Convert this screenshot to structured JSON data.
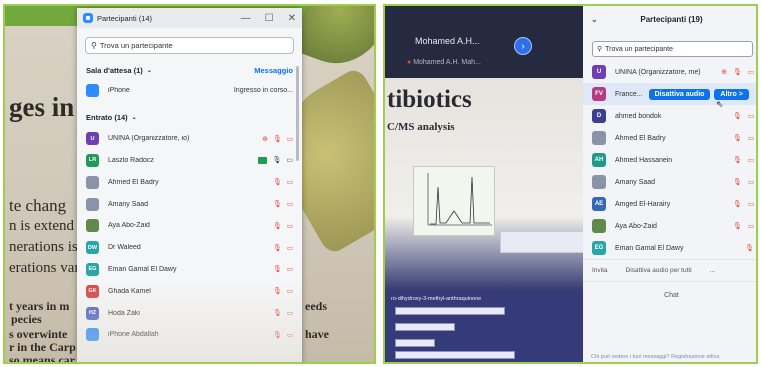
{
  "left": {
    "slide_lines": [
      "ges in",
      "te chang",
      "n is extend",
      "nerations is",
      "erations var",
      "t years in m",
      "pecies",
      "s  overwinte",
      "r in the Carp",
      "so means car"
    ],
    "window": {
      "title": "Partecipanti (14)",
      "controls": [
        "—",
        "☐",
        "✕"
      ],
      "search_placeholder": "Trova un partecipante",
      "waiting_room": {
        "label": "Sala d'attesa (1)",
        "action": "Messaggio"
      },
      "waiting": [
        {
          "name": "iPhone",
          "status": "Ingresso in corso..."
        }
      ],
      "entered_label": "Entrato (14)",
      "participants": [
        {
          "initials": "U",
          "name": "UNINA (Organizzatore, io)",
          "color": "#6d3fb2"
        },
        {
          "initials": "LR",
          "name": "Laszlo Radocz",
          "color": "#1f9b55"
        },
        {
          "initials": "",
          "name": "Ahmed El Badry",
          "color": "#8a94a6"
        },
        {
          "initials": "",
          "name": "Amany Saad",
          "color": "#8a94a6"
        },
        {
          "initials": "",
          "name": "Aya Abo-Zaid",
          "color": "#5f8a4b"
        },
        {
          "initials": "DW",
          "name": "Dr Waleed",
          "color": "#2aa6a6"
        },
        {
          "initials": "EG",
          "name": "Eman Gamal El Dawy",
          "color": "#2aa6a6"
        },
        {
          "initials": "GK",
          "name": "Ghada Kamel",
          "color": "#d64a4a"
        },
        {
          "initials": "HZ",
          "name": "Hoda Zaki",
          "color": "#5566c8"
        },
        {
          "initials": "",
          "name": "iPhone Abdallah",
          "color": "#2d8cff"
        }
      ]
    }
  },
  "right": {
    "video_names": [
      "Mohamed  A.H...",
      "Mohamed A.H. Mah..."
    ],
    "slide_lines": [
      "tibiotics",
      "C/MS analysis"
    ],
    "slide_caption": "ro-dihydroxy-3-methyl-anthraquinone",
    "panel": {
      "title": "Partecipanti (19)",
      "search_placeholder": "Trova un partecipante",
      "hover_buttons": [
        "Disattiva audio",
        "Altro >"
      ],
      "participants": [
        {
          "initials": "U",
          "name": "UNINA (Organizzatore, me)",
          "color": "#6d3fb2"
        },
        {
          "initials": "FV",
          "name": "France...",
          "color": "#b43c82"
        },
        {
          "initials": "D",
          "name": "ahmed bondok",
          "color": "#3b3f8f"
        },
        {
          "initials": "",
          "name": "Ahmed El Badry",
          "color": "#8a94a6"
        },
        {
          "initials": "AH",
          "name": "Ahmed Hassanein",
          "color": "#1f9b8a"
        },
        {
          "initials": "",
          "name": "Amany Saad",
          "color": "#8a94a6"
        },
        {
          "initials": "AE",
          "name": "Amged El-Harairy",
          "color": "#3569b8"
        },
        {
          "initials": "",
          "name": "Aya Abo-Zaid",
          "color": "#5f8a4b"
        },
        {
          "initials": "EG",
          "name": "Eman Gamal El Dawy",
          "color": "#2aa6a6"
        }
      ],
      "footer": [
        "Invita",
        "Disattiva audio per tutti",
        "..."
      ],
      "chat_label": "Chat",
      "chat_note": "Chi può vedere i tuoi messaggi? Registrazione attiva"
    }
  },
  "icons": {
    "muted": "🎙̸",
    "camera_off": "⊘"
  }
}
